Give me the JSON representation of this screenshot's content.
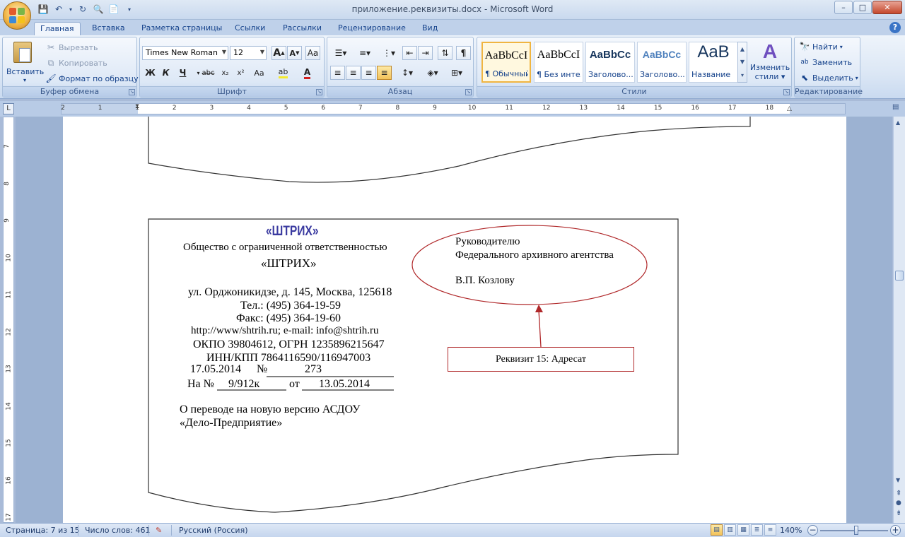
{
  "window": {
    "title": "приложение.реквизиты.docx - Microsoft Word",
    "minimize": "–",
    "maximize": "□",
    "close": "✕"
  },
  "tabs": [
    "Главная",
    "Вставка",
    "Разметка страницы",
    "Ссылки",
    "Рассылки",
    "Рецензирование",
    "Вид"
  ],
  "ribbon": {
    "clipboard": {
      "label": "Буфер обмена",
      "paste": "Вставить",
      "cut": "Вырезать",
      "copy": "Копировать",
      "format_painter": "Формат по образцу"
    },
    "font": {
      "label": "Шрифт",
      "font_name": "Times New Roman",
      "font_size": "12",
      "bold": "Ж",
      "italic": "К",
      "underline": "Ч",
      "strike": "abc",
      "subscript": "x₂",
      "superscript": "x²",
      "change_case": "Aa",
      "grow": "A",
      "shrink": "A"
    },
    "paragraph": {
      "label": "Абзац"
    },
    "styles": {
      "label": "Стили",
      "items": [
        {
          "sample": "AaBbCcI",
          "name": "¶ Обычный"
        },
        {
          "sample": "AaBbCcI",
          "name": "¶ Без инте..."
        },
        {
          "sample": "AaBbCc",
          "name": "Заголово..."
        },
        {
          "sample": "AaBbCc",
          "name": "Заголово..."
        },
        {
          "sample": "AaB",
          "name": "Название"
        }
      ],
      "change_styles": "Изменить",
      "change_styles_2": "стили"
    },
    "editing": {
      "label": "Редактирование",
      "find": "Найти",
      "replace": "Заменить",
      "select": "Выделить"
    }
  },
  "ruler": {
    "h_numbers": [
      "2",
      "1",
      "1",
      "2",
      "3",
      "4",
      "5",
      "6",
      "7",
      "8",
      "9",
      "10",
      "11",
      "12",
      "13",
      "14",
      "15",
      "16",
      "17",
      "18"
    ],
    "v_numbers": [
      "7",
      "8",
      "9",
      "10",
      "11",
      "12",
      "13",
      "14",
      "15",
      "16",
      "17"
    ]
  },
  "document": {
    "logo": "«ШТРИХ»",
    "org_name": "Общество с ограниченной ответственностью",
    "org_short": "«ШТРИХ»",
    "address": "ул. Орджоникидзе, д. 145, Москва, 125618",
    "phone": "Тел.: (495) 364-19-59",
    "fax": "Факс:  (495) 364-19-60",
    "web": "http://www/shtrih.ru; e-mail:  info@shtrih.ru",
    "okpo": "ОКПО 39804612, ОГРН 1235896215647",
    "inn": "ИНН/КПП 7864116590/116947003",
    "date": "17.05.2014",
    "num_label": "№",
    "num": "273",
    "on_label": "На №",
    "on_num": "9/912к",
    "from_label": "от",
    "from_date": "13.05.2014",
    "subject_1": "О переводе на новую версию АСДОУ",
    "subject_2": "«Дело-Предприятие»",
    "addressee_1": "Руководителю",
    "addressee_2": "Федерального архивного агентства",
    "addressee_3": "В.П. Козлову",
    "callout": "Реквизит 15: Адресат"
  },
  "status": {
    "page": "Страница: 7 из 15",
    "words": "Число слов: 461",
    "language": "Русский (Россия)",
    "zoom": "140%"
  },
  "colors": {
    "logo": "#3a3aa0",
    "ellipse": "#b0282a",
    "arrow": "#b0282a",
    "callout_border": "#b0282a"
  }
}
